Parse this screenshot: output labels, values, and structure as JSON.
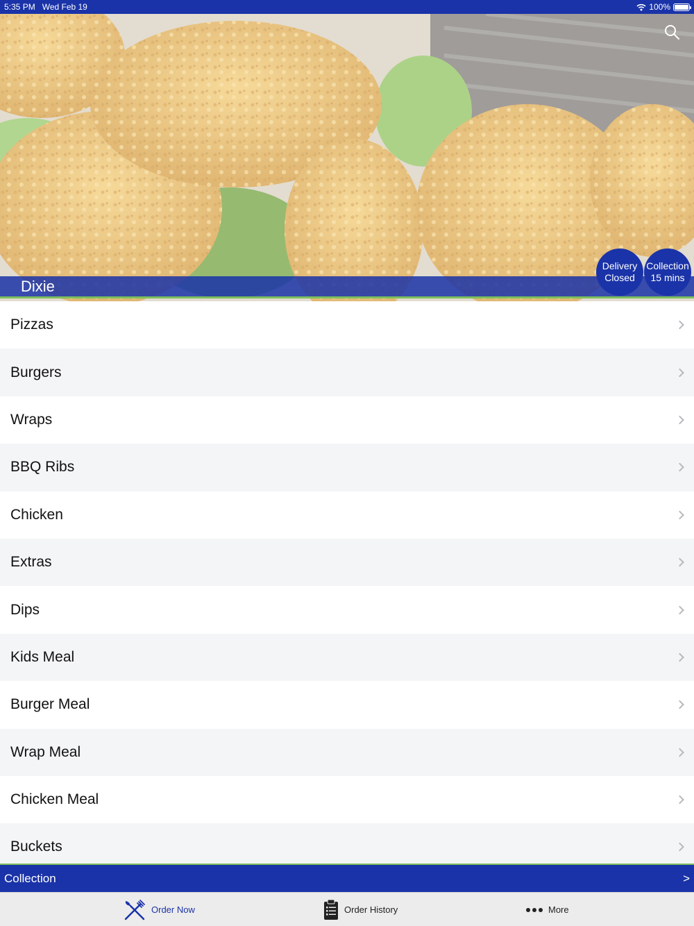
{
  "status_bar": {
    "time": "5:35 PM",
    "date": "Wed Feb 19",
    "battery": "100%",
    "battery_level": 1.0,
    "icons": [
      "wifi-icon",
      "battery-icon"
    ]
  },
  "header": {
    "restaurant_name": "Dixie",
    "search_icon": "search-icon"
  },
  "badges": {
    "delivery": {
      "label": "Delivery",
      "value": "Closed"
    },
    "collection": {
      "label": "Collection",
      "value": "15 mins"
    }
  },
  "menu": {
    "categories": [
      "Pizzas",
      "Burgers",
      "Wraps",
      "BBQ Ribs",
      "Chicken",
      "Extras",
      "Dips",
      "Kids Meal",
      "Burger Meal",
      "Wrap Meal",
      "Chicken Meal",
      "Buckets"
    ]
  },
  "order_mode": {
    "label": "Collection",
    "arrow": ">"
  },
  "tabs": [
    {
      "label": "Order Now",
      "icon": "fork-knife-icon",
      "active": true
    },
    {
      "label": "Order History",
      "icon": "clipboard-icon",
      "active": false
    },
    {
      "label": "More",
      "icon": "more-dots-icon",
      "active": false
    }
  ],
  "colors": {
    "brand_blue": "#1a33a8",
    "accent_green": "#7dbf5a",
    "row_alt": "#f4f5f7"
  }
}
